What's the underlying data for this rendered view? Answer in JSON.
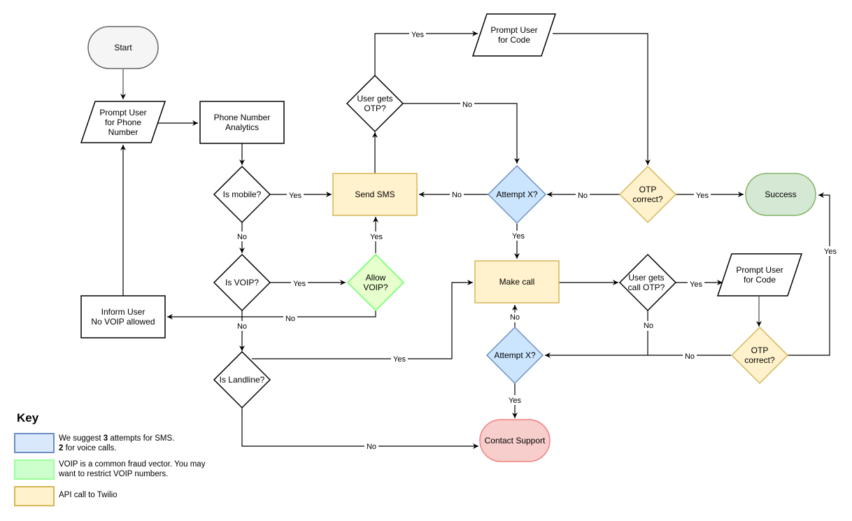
{
  "colors": {
    "blue_fill": "#dae8fc",
    "blue_stroke": "#6c8ebf",
    "green_fill": "#ccffcc",
    "green_stroke": "#66ff66",
    "yellow_fill": "#fff2cc",
    "yellow_stroke": "#d6b656",
    "success_fill": "#d5e8d4",
    "success_stroke": "#82b366",
    "support_fill": "#f8cecc",
    "support_stroke": "#f08080",
    "start_fill": "#f5f5f5",
    "start_stroke": "#666666",
    "attempt_fill": "#cce5ff",
    "allow_fill": "#e6ffcc"
  },
  "nodes": {
    "start": {
      "lines": [
        "Start"
      ]
    },
    "prompt_phone": {
      "lines": [
        "Prompt User",
        "for Phone",
        "Number"
      ]
    },
    "phone_analytics": {
      "lines": [
        "Phone Number",
        "Analytics"
      ]
    },
    "is_mobile": {
      "lines": [
        "Is mobile?"
      ]
    },
    "is_voip": {
      "lines": [
        "Is VOIP?"
      ]
    },
    "is_landline": {
      "lines": [
        "Is Landline?"
      ]
    },
    "inform_user": {
      "lines": [
        "Inform User",
        "No VOIP allowed"
      ]
    },
    "send_sms": {
      "lines": [
        "Send SMS"
      ]
    },
    "allow_voip": {
      "lines": [
        "Allow",
        "VOIP?"
      ]
    },
    "user_gets_otp": {
      "lines": [
        "User gets",
        "OTP?"
      ]
    },
    "prompt_code_1": {
      "lines": [
        "Prompt User",
        "for Code"
      ]
    },
    "attempt_sms": {
      "lines": [
        "Attempt X?"
      ]
    },
    "otp_correct_1": {
      "lines": [
        "OTP",
        "correct?"
      ]
    },
    "success": {
      "lines": [
        "Success"
      ]
    },
    "make_call": {
      "lines": [
        "Make call"
      ]
    },
    "user_gets_call_otp": {
      "lines": [
        "User gets",
        "call OTP?"
      ]
    },
    "prompt_code_2": {
      "lines": [
        "Prompt User",
        "for Code"
      ]
    },
    "otp_correct_2": {
      "lines": [
        "OTP",
        "correct?"
      ]
    },
    "attempt_call": {
      "lines": [
        "Attempt X?"
      ]
    },
    "contact_support": {
      "lines": [
        "Contact Support"
      ]
    }
  },
  "edge_labels": {
    "mobile_yes": "Yes",
    "mobile_no": "No",
    "voip_yes": "Yes",
    "voip_no": "No",
    "allow_yes": "Yes",
    "allow_no": "No",
    "otp_yes": "Yes",
    "otp_no": "No",
    "attempt_sms_no": "No",
    "attempt_sms_yes": "Yes",
    "otp1_no": "No",
    "otp1_yes": "Yes",
    "call_otp_yes": "Yes",
    "call_otp_no": "No",
    "otp2_no": "No",
    "otp2_yes": "Yes",
    "attempt_call_no": "No",
    "attempt_call_yes": "Yes",
    "landline_yes": "Yes",
    "landline_no": "No"
  },
  "key": {
    "title": "Key",
    "items": [
      {
        "lines": [
          {
            "parts": [
              [
                "We suggest ",
                false
              ],
              [
                "3",
                true
              ],
              [
                " attempts for SMS.",
                false
              ]
            ]
          },
          {
            "parts": [
              [
                "2",
                true
              ],
              [
                " for voice calls.",
                false
              ]
            ]
          }
        ]
      },
      {
        "lines": [
          {
            "parts": [
              [
                "VOIP is a common fraud vector.  You may",
                false
              ]
            ]
          },
          {
            "parts": [
              [
                "want to restrict VOIP numbers.",
                false
              ]
            ]
          }
        ]
      },
      {
        "lines": [
          {
            "parts": [
              [
                "API call to Twilio",
                false
              ]
            ]
          }
        ]
      }
    ]
  }
}
